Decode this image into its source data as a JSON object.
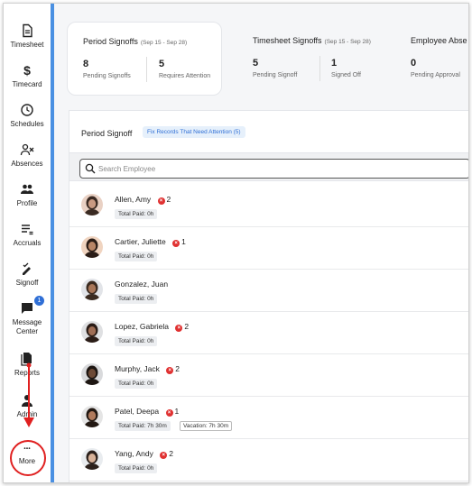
{
  "sidebar": {
    "items": [
      {
        "label": "Timesheet",
        "icon": "timesheet-icon"
      },
      {
        "label": "Timecard",
        "icon": "dollar-icon"
      },
      {
        "label": "Schedules",
        "icon": "clock-icon"
      },
      {
        "label": "Absences",
        "icon": "person-x-icon"
      },
      {
        "label": "Profile",
        "icon": "people-icon"
      },
      {
        "label": "Accruals",
        "icon": "accruals-icon"
      },
      {
        "label": "Signoff",
        "icon": "signoff-icon"
      },
      {
        "label_line1": "Message",
        "label_line2": "Center",
        "icon": "message-icon",
        "badge": "1"
      },
      {
        "label": "Reports",
        "icon": "reports-icon"
      },
      {
        "label": "Admin",
        "icon": "admin-icon"
      },
      {
        "label": "More",
        "icon": "more-icon"
      }
    ]
  },
  "summary": {
    "period": {
      "title": "Period Signoffs",
      "range": "(Sep 15 - Sep 28)",
      "pending_value": "8",
      "pending_label": "Pending Signoffs",
      "attention_value": "5",
      "attention_label": "Requires Attention"
    },
    "timesheet": {
      "title": "Timesheet Signoffs",
      "range": "(Sep 15 - Sep 28)",
      "pending_value": "5",
      "pending_label": "Pending Signoff",
      "signed_value": "1",
      "signed_label": "Signed Off"
    },
    "employee": {
      "title": "Employee Abse",
      "pending_value": "0",
      "pending_label": "Pending Approval"
    }
  },
  "panel": {
    "title": "Period Signoff",
    "fix_button": "Fix Records That Need Attention (5)",
    "search_placeholder": "Search Employee"
  },
  "employees": [
    {
      "name": "Allen, Amy",
      "errors": "2",
      "tags": [
        "Total Paid: 0h"
      ]
    },
    {
      "name": "Cartier, Juliette",
      "errors": "1",
      "tags": [
        "Total Paid: 0h"
      ]
    },
    {
      "name": "Gonzalez, Juan",
      "errors": "",
      "tags": [
        "Total Paid: 0h"
      ]
    },
    {
      "name": "Lopez, Gabriela",
      "errors": "2",
      "tags": [
        "Total Paid: 0h"
      ]
    },
    {
      "name": "Murphy, Jack",
      "errors": "2",
      "tags": [
        "Total Paid: 0h"
      ]
    },
    {
      "name": "Patel, Deepa",
      "errors": "1",
      "tags": [
        "Total Paid: 7h 30m",
        "Vacation: 7h 30m"
      ]
    },
    {
      "name": "Yang, Andy",
      "errors": "2",
      "tags": [
        "Total Paid: 0h"
      ]
    }
  ],
  "colors": {
    "accent": "#4a90e2",
    "error": "#e03131",
    "annotation": "#e02020"
  }
}
